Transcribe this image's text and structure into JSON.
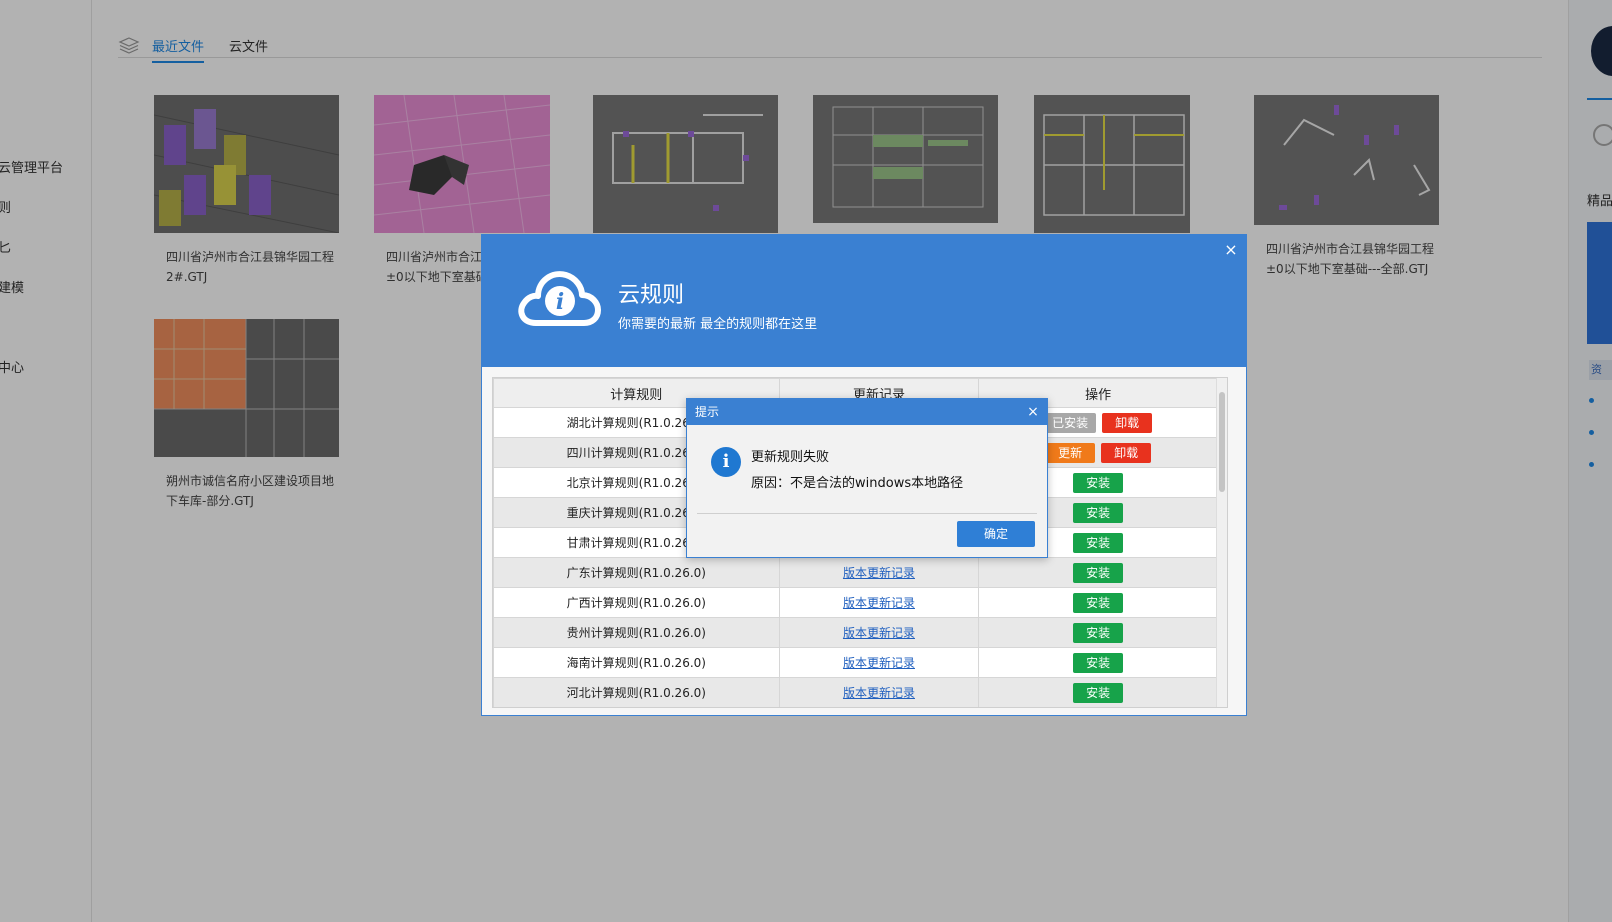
{
  "left_sidebar": {
    "items": [
      {
        "label": "云管理平台"
      },
      {
        "label": "则"
      },
      {
        "label": "匕"
      },
      {
        "label": "建模"
      },
      {
        "label": "中心"
      }
    ]
  },
  "tabs": [
    {
      "label": "最近文件",
      "active": true
    },
    {
      "label": "云文件",
      "active": false
    }
  ],
  "files": [
    {
      "name": "四川省泸州市合江县锦华园工程2#.GTJ"
    },
    {
      "name": "四川省泸州市合江县锦华园工程±0以下地下室基础..."
    },
    {
      "name": ""
    },
    {
      "name": ""
    },
    {
      "name": ""
    },
    {
      "name": "四川省泸州市合江县锦华园工程±0以下地下室基础---全部.GTJ"
    },
    {
      "name": "朔州市诚信名府小区建设项目地下车库-部分.GTJ"
    }
  ],
  "right_strip": {
    "label1": "精品",
    "label2": "资"
  },
  "cloud_dialog": {
    "title": "云规则",
    "subtitle": "你需要的最新 最全的规则都在这里",
    "close": "×",
    "columns": [
      "计算规则",
      "更新记录",
      "操作"
    ],
    "rows": [
      {
        "rule": "湖北计算规则(R1.0.26.0)",
        "log": "",
        "ops": [
          "已安装",
          "卸载"
        ]
      },
      {
        "rule": "四川计算规则(R1.0.26.0)",
        "log": "",
        "ops": [
          "更新",
          "卸载"
        ]
      },
      {
        "rule": "北京计算规则(R1.0.26.0)",
        "log": "",
        "ops": [
          "安装"
        ]
      },
      {
        "rule": "重庆计算规则(R1.0.26.0)",
        "log": "",
        "ops": [
          "安装"
        ]
      },
      {
        "rule": "甘肃计算规则(R1.0.26.0)",
        "log": "",
        "ops": [
          "安装"
        ]
      },
      {
        "rule": "广东计算规则(R1.0.26.0)",
        "log": "版本更新记录",
        "ops": [
          "安装"
        ]
      },
      {
        "rule": "广西计算规则(R1.0.26.0)",
        "log": "版本更新记录",
        "ops": [
          "安装"
        ]
      },
      {
        "rule": "贵州计算规则(R1.0.26.0)",
        "log": "版本更新记录",
        "ops": [
          "安装"
        ]
      },
      {
        "rule": "海南计算规则(R1.0.26.0)",
        "log": "版本更新记录",
        "ops": [
          "安装"
        ]
      },
      {
        "rule": "河北计算规则(R1.0.26.0)",
        "log": "版本更新记录",
        "ops": [
          "安装"
        ]
      }
    ]
  },
  "alert": {
    "title": "提示",
    "close": "×",
    "icon": "info-icon",
    "message": "更新规则失败",
    "reason": "原因：不是合法的windows本地路径",
    "ok_label": "确定"
  },
  "colors": {
    "accent": "#3a80d2",
    "tab_active": "#1e88e5",
    "install_green": "#17a34a",
    "uninstall_red": "#e8321e",
    "update_orange": "#f07a1a",
    "installed_gray": "#a8a8a8"
  }
}
